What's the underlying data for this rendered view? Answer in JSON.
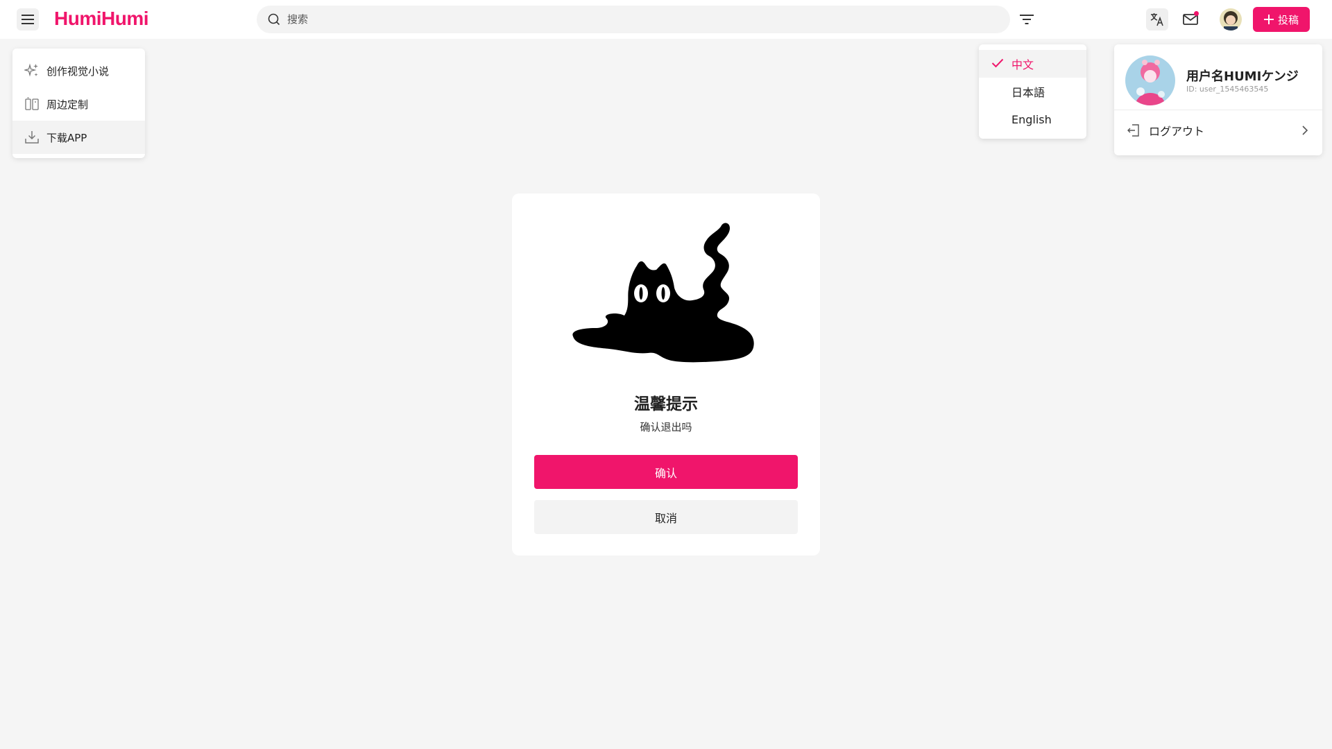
{
  "header": {
    "logo_text": "HumiHumi",
    "search_placeholder": "搜索",
    "post_label": "投稿",
    "brand_color": "#f0156b"
  },
  "left_menu": {
    "items": [
      {
        "label": "创作视觉小说",
        "icon": "sparkle-icon"
      },
      {
        "label": "周边定制",
        "icon": "merch-icon"
      },
      {
        "label": "下载APP",
        "icon": "download-icon"
      }
    ]
  },
  "language_menu": {
    "selected": "中文",
    "items": [
      {
        "label": "中文"
      },
      {
        "label": "日本語"
      },
      {
        "label": "English"
      }
    ]
  },
  "user_panel": {
    "name": "用户名HUMIケンジ",
    "id": "ID: user_1545463545",
    "logout_label": "ログアウト"
  },
  "dialog": {
    "title": "温馨提示",
    "message": "确认退出吗",
    "confirm_label": "确认",
    "cancel_label": "取消"
  }
}
